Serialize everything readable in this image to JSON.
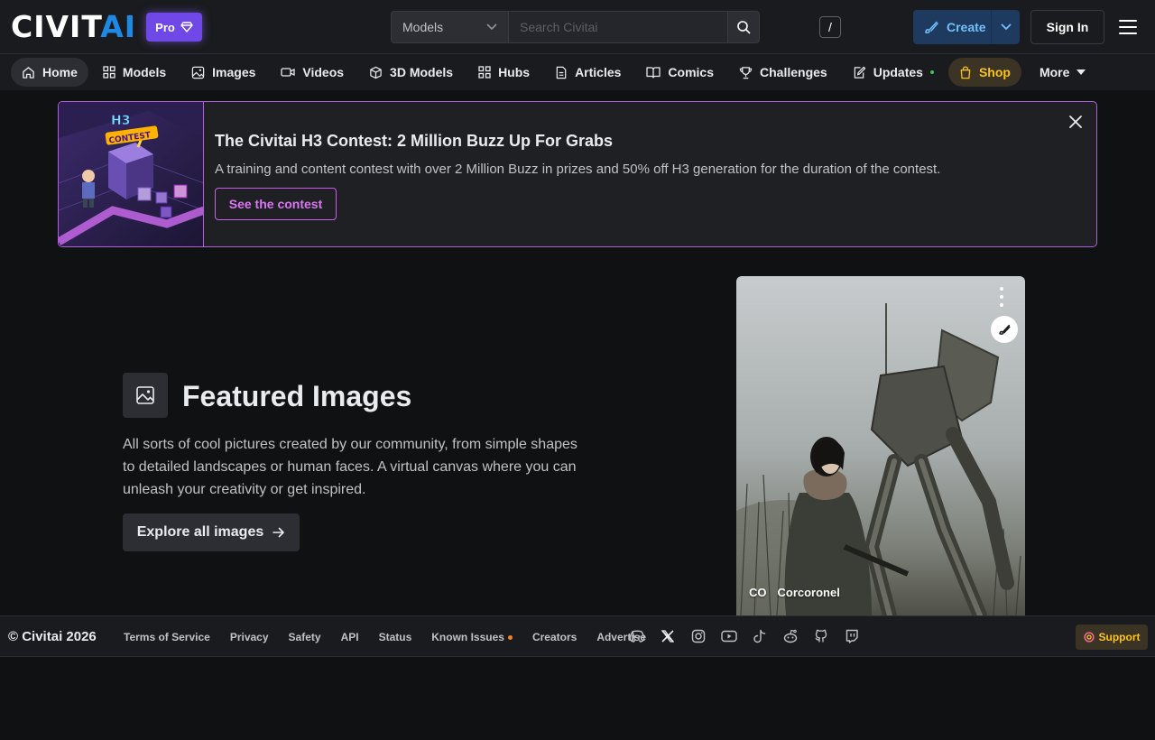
{
  "header": {
    "logo": {
      "part1": "CIVIT",
      "part2": "AI"
    },
    "pro_label": "Pro",
    "search": {
      "scope": "Models",
      "placeholder": "Search Civitai",
      "shortcut": "/"
    },
    "create_label": "Create",
    "signin_label": "Sign In"
  },
  "nav": {
    "items": [
      {
        "label": "Home",
        "icon": "home-icon"
      },
      {
        "label": "Models",
        "icon": "grid-icon"
      },
      {
        "label": "Images",
        "icon": "photo-icon"
      },
      {
        "label": "Videos",
        "icon": "video-icon"
      },
      {
        "label": "3D Models",
        "icon": "cube-icon"
      },
      {
        "label": "Hubs",
        "icon": "grid-icon"
      },
      {
        "label": "Articles",
        "icon": "file-text-icon"
      },
      {
        "label": "Comics",
        "icon": "book-icon"
      },
      {
        "label": "Challenges",
        "icon": "trophy-icon"
      },
      {
        "label": "Updates",
        "icon": "edit-icon"
      },
      {
        "label": "Shop",
        "icon": "shopping-bag-icon"
      },
      {
        "label": "More",
        "icon": "caret-down-icon"
      }
    ]
  },
  "banner": {
    "art_text": "H3 CONTEST",
    "title": "The Civitai H3 Contest: 2 Million Buzz Up For Grabs",
    "description": "A training and content contest with over 2 Million Buzz in prizes and 50% off H3 generation for the duration of the contest.",
    "button_label": "See the contest"
  },
  "featured": {
    "title": "Featured Images",
    "description": "All sorts of cool pictures created by our community, from simple shapes to detailed landscapes or human faces. A virtual canvas where you can unleash your creativity or get inspired.",
    "button_label": "Explore all images"
  },
  "card": {
    "user_initials": "CO",
    "username": "Corcoronel"
  },
  "footer": {
    "copyright": "© Civitai 2026",
    "links": [
      "Terms of Service",
      "Privacy",
      "Safety",
      "API",
      "Status",
      "Known Issues",
      "Creators",
      "Advertise"
    ],
    "support_label": "Support"
  },
  "colors": {
    "background": "#1a1b1e",
    "accent_blue": "#1e88e5",
    "pro_purple": "#7048e8",
    "banner_border": "#b05fd6",
    "shop_yellow": "#fcc419"
  }
}
